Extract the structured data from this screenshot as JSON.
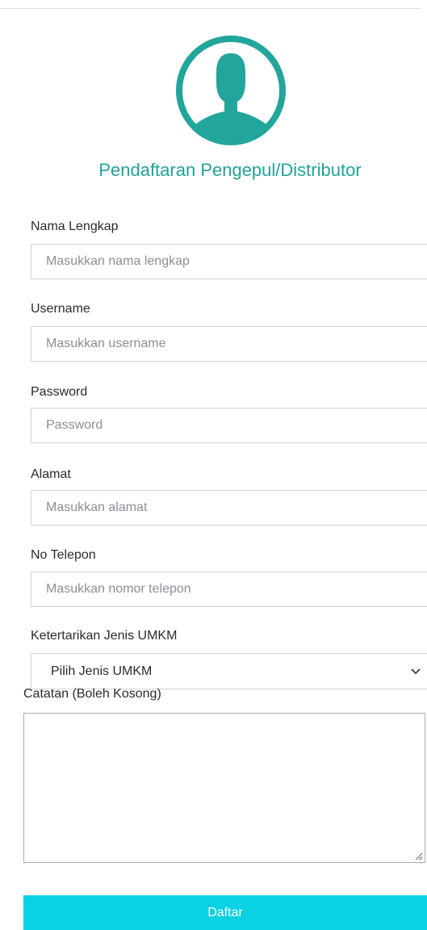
{
  "header": {
    "avatar_icon": "user-avatar-icon",
    "title": "Pendaftaran Pengepul/Distributor",
    "accent_color": "#21a39a"
  },
  "form": {
    "full_name": {
      "label": "Nama Lengkap",
      "placeholder": "Masukkan nama lengkap",
      "value": ""
    },
    "username": {
      "label": "Username",
      "placeholder": "Masukkan username",
      "value": ""
    },
    "password": {
      "label": "Password",
      "placeholder": "Password",
      "value": ""
    },
    "address": {
      "label": "Alamat",
      "placeholder": "Masukkan alamat",
      "value": ""
    },
    "phone": {
      "label": "No Telepon",
      "placeholder": "Masukkan nomor telepon",
      "value": ""
    },
    "umkm_type": {
      "label": "Ketertarikan Jenis UMKM",
      "selected": "Pilih Jenis UMKM",
      "icon": "chevron-down-icon"
    },
    "notes": {
      "label": "Catatan (Boleh Kosong)",
      "value": ""
    },
    "submit_label": "Daftar",
    "submit_color": "#0ad1e3"
  }
}
